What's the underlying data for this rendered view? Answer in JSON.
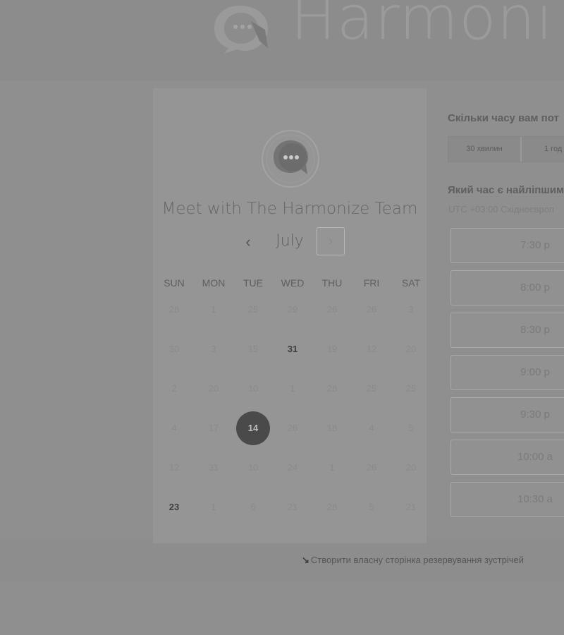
{
  "header": {
    "brand_text": "Harmoni",
    "logo_icon": "chat-bubble-logo-icon"
  },
  "card": {
    "title": "Meet with The Harmonize Team",
    "month": "July",
    "prev_symbol": "‹",
    "next_symbol": "›",
    "weekdays": [
      "SUN",
      "MON",
      "TUE",
      "WED",
      "THU",
      "FRI",
      "SAT"
    ],
    "weeks": [
      [
        "28",
        "1",
        "25",
        "29",
        "26",
        "26",
        "3"
      ],
      [
        "30",
        "3",
        "15",
        "31",
        "19",
        "12",
        "20"
      ],
      [
        "2",
        "20",
        "10",
        "1",
        "28",
        "25",
        "25"
      ],
      [
        "4",
        "17",
        "14",
        "26",
        "18",
        "4",
        "5"
      ],
      [
        "12",
        "31",
        "10",
        "24",
        "1",
        "26",
        "20"
      ],
      [
        "23",
        "1",
        "6",
        "21",
        "28",
        "5",
        "21"
      ]
    ],
    "active_days": [
      "31",
      "23"
    ],
    "selected_day": "14"
  },
  "duration": {
    "question": "Скільки часу вам пот",
    "options": [
      "30 хвилин",
      "1 год"
    ]
  },
  "time_pick": {
    "question": "Який час є найліпшим",
    "timezone": "UTC +03:00 Східноєвроп",
    "slots": [
      "7:30 p",
      "8:00 p",
      "8:30 p",
      "9:00 p",
      "9:30 p",
      "10:00 a",
      "10:30 a"
    ]
  },
  "footer": {
    "link_text": "Створити власну сторінка резервування зустрічей",
    "link_icon": "arrow-icon"
  }
}
